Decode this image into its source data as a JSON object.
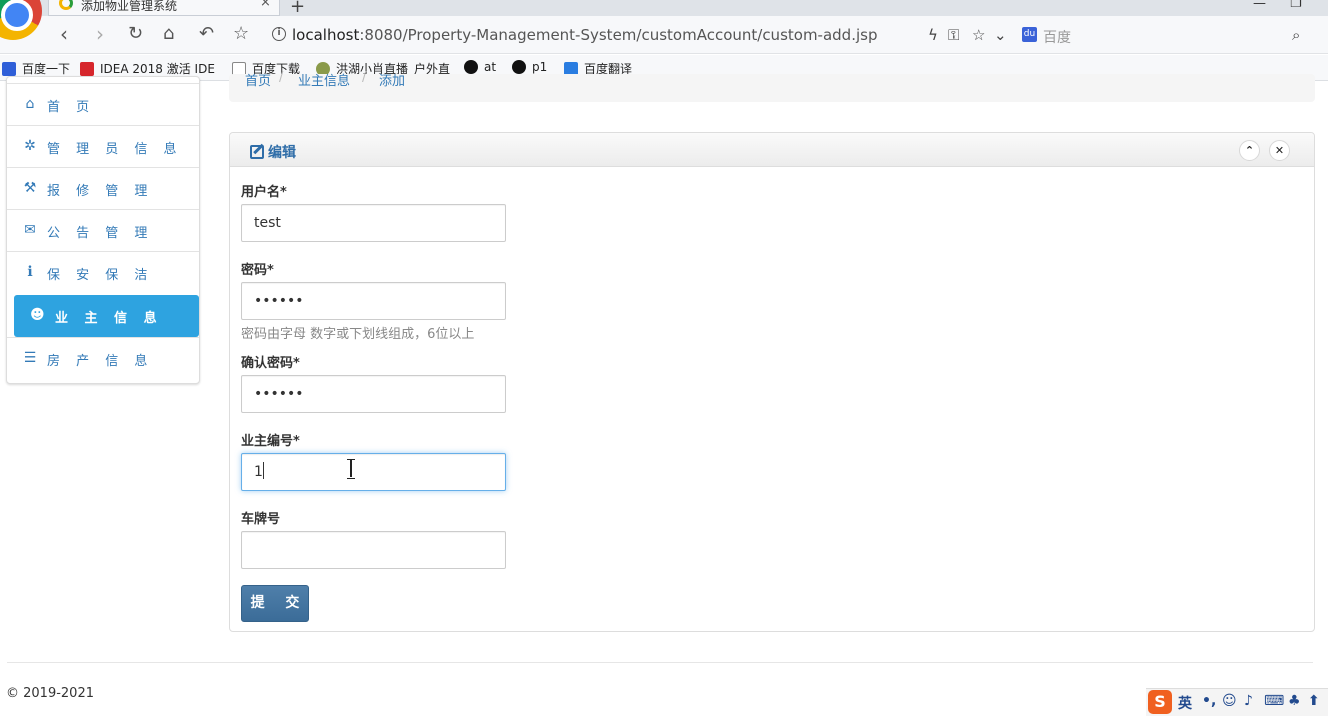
{
  "browser": {
    "tab_title": "添加物业管理系统",
    "tab_close": "×",
    "new_tab": "+",
    "url_host": "localhost",
    "url_path": ":8080/Property-Management-System/customAccount/custom-add.jsp",
    "search_placeholder": "百度",
    "bookmarks": [
      {
        "label": "百度一下",
        "icon": "baidu-paw-icon",
        "color": "#2f5fd8"
      },
      {
        "label": "IDEA 2018 激活 IDE",
        "icon": "c-logo-icon",
        "color": "#d6262c"
      },
      {
        "label": "百度下载",
        "icon": "page-icon",
        "color": "#888888"
      },
      {
        "label": "洪湖小肖直播_户外直",
        "icon": "bird-icon",
        "color": "#6a7a3a"
      },
      {
        "label": "at",
        "icon": "github-icon",
        "color": "#111111"
      },
      {
        "label": "p1",
        "icon": "github-icon",
        "color": "#111111"
      },
      {
        "label": "百度翻译",
        "icon": "translate-icon",
        "color": "#2a7de1"
      }
    ]
  },
  "sidebar": {
    "items": [
      {
        "label": "首 页",
        "icon": "home-icon",
        "glyph": "⌂",
        "active": false
      },
      {
        "label": "管 理 员 信 息",
        "icon": "gear-icon",
        "glyph": "✲",
        "active": false
      },
      {
        "label": "报 修 管 理",
        "icon": "wrench-icon",
        "glyph": "⚒",
        "active": false
      },
      {
        "label": "公 告 管 理",
        "icon": "envelope-icon",
        "glyph": "✉",
        "active": false
      },
      {
        "label": "保 安 保 洁",
        "icon": "info-icon",
        "glyph": "ℹ",
        "active": false
      },
      {
        "label": "业 主 信 息",
        "icon": "user-icon",
        "glyph": "☻",
        "active": true
      },
      {
        "label": "房 产 信 息",
        "icon": "list-icon",
        "glyph": "☰",
        "active": false
      }
    ]
  },
  "breadcrumb": {
    "items": [
      "首页",
      "业主信息",
      "添加"
    ],
    "separator": "/"
  },
  "panel": {
    "title": "编辑",
    "collapse_glyph": "⌃",
    "close_glyph": "✕"
  },
  "form": {
    "username": {
      "label": "用户名*",
      "value": "test"
    },
    "password": {
      "label": "密码*",
      "value": "••••••",
      "help": "密码由字母 数字或下划线组成，6位以上"
    },
    "confirm_password": {
      "label": "确认密码*",
      "value": "••••••"
    },
    "owner_id": {
      "label": "业主编号*",
      "value": "1"
    },
    "plate": {
      "label": "车牌号",
      "value": ""
    },
    "submit_label": "提 交"
  },
  "footer": {
    "copyright": "© 2019-2021"
  },
  "ime": {
    "logo": "S",
    "mode": "英"
  },
  "colors": {
    "accent": "#337ab7",
    "active_nav": "#2ea3e0",
    "submit": "#3b6c98"
  }
}
